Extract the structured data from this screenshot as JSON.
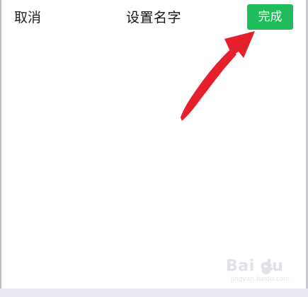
{
  "header": {
    "cancel_label": "取消",
    "title": "设置名字",
    "done_label": "完成"
  },
  "annotation": {
    "arrow_color": "#e51f2b"
  },
  "watermark": {
    "main": "Bai du",
    "sub": "jingyan.baidu.com",
    "icon": "paw-icon"
  },
  "colors": {
    "primary_green": "#1fbd59",
    "background": "#ffffff",
    "text": "#1f1f1f"
  }
}
